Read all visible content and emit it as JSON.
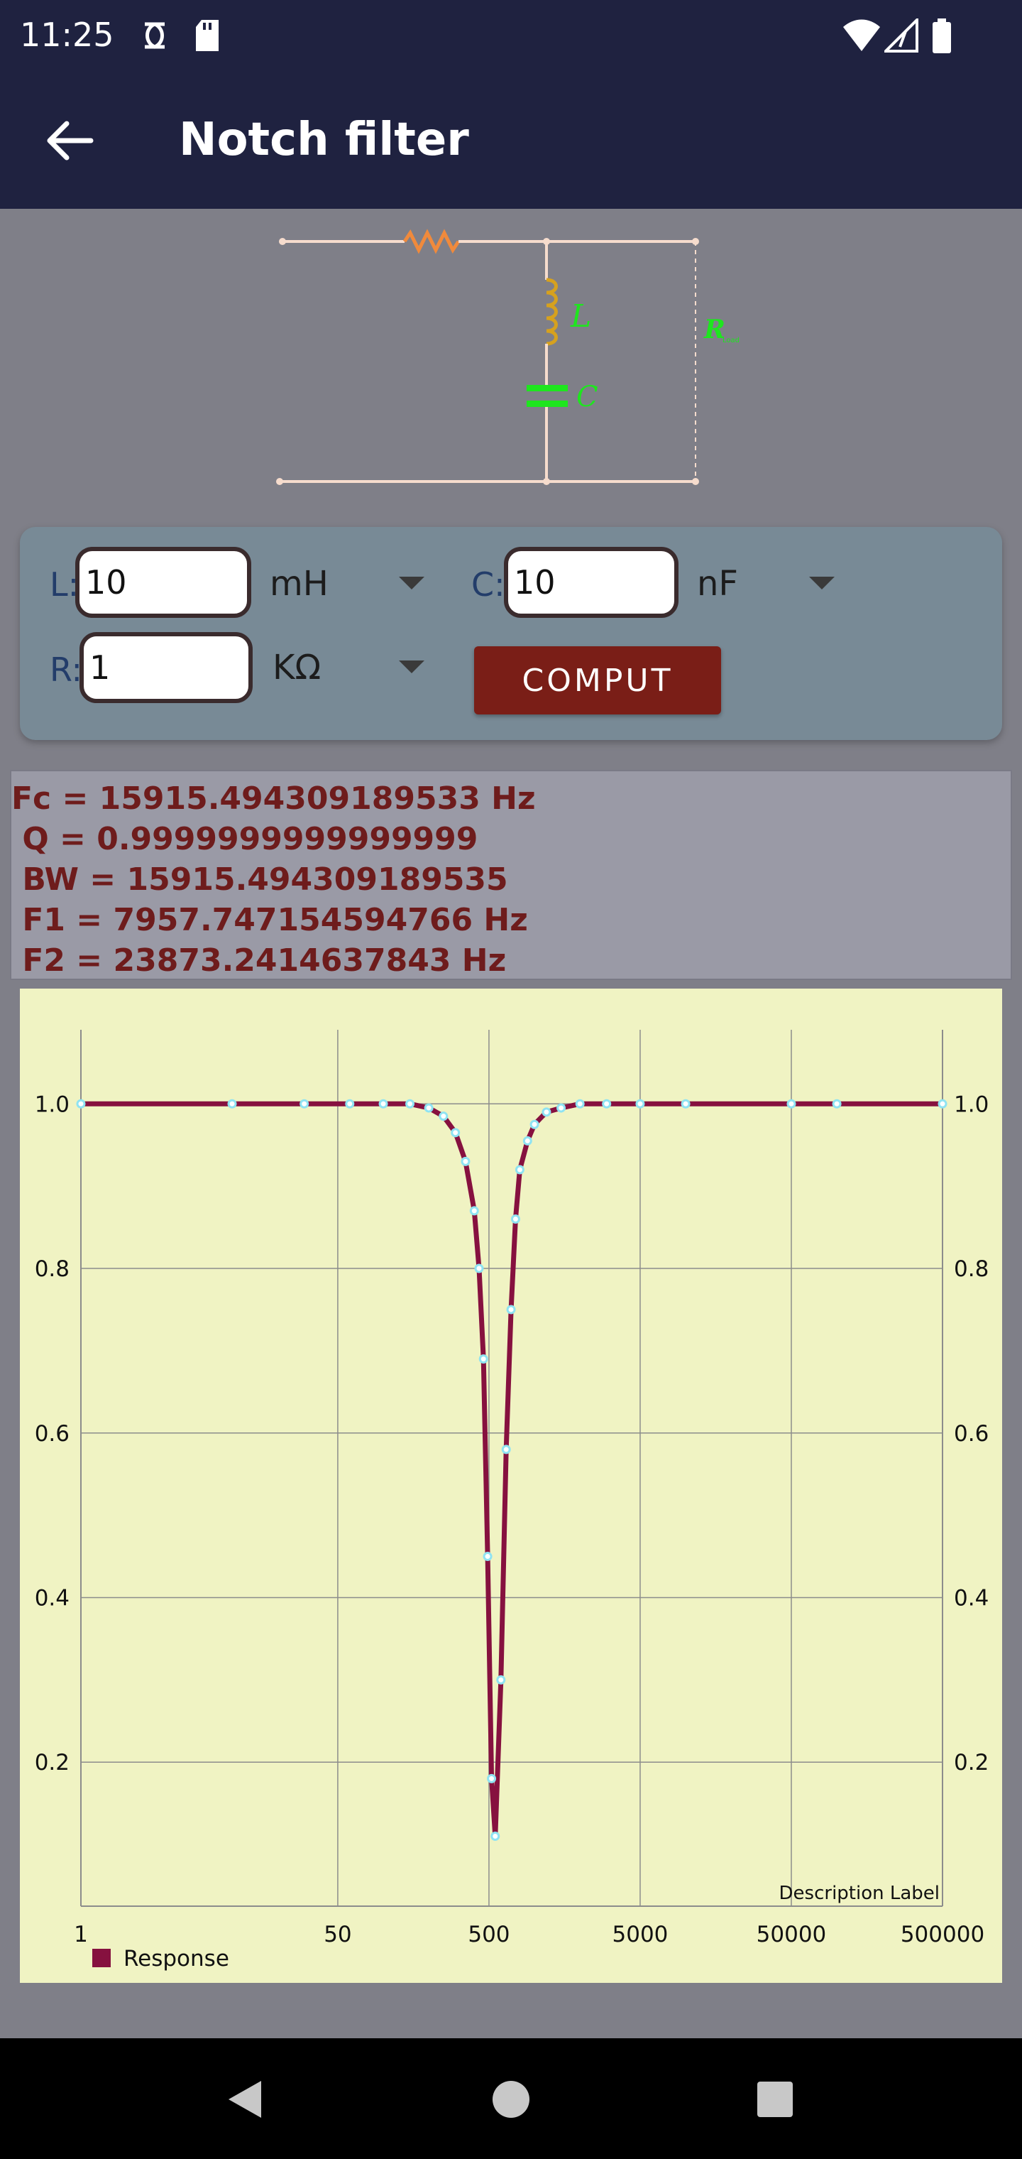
{
  "status": {
    "time": "11:25"
  },
  "app_bar": {
    "title": "Notch filter"
  },
  "diagram": {
    "label_l": "L",
    "label_c": "C",
    "label_r": "R",
    "label_r_sub": "Load"
  },
  "inputs": {
    "l": {
      "label": "L:",
      "value": "10",
      "unit": "mH"
    },
    "c": {
      "label": "C:",
      "value": "10",
      "unit": "nF"
    },
    "r": {
      "label": "R:",
      "value": "1",
      "unit": "KΩ"
    },
    "compute_label": "COMPUT"
  },
  "results": {
    "fc": "Fc = 15915.494309189533 Hz",
    "q": " Q = 0.9999999999999999",
    "bw": " BW = 15915.494309189535",
    "f1": " F1 = 7957.747154594766 Hz",
    "f2": " F2 = 23873.2414637843 Hz"
  },
  "colors": {
    "line": "#86113f",
    "marker": "#8fe3f2",
    "bg": "#f0f3c3"
  },
  "chart_data": {
    "type": "line",
    "xscale": "log",
    "x_ticks": [
      1,
      50,
      500,
      5000,
      50000,
      500000
    ],
    "x_tick_labels": [
      "1",
      "50",
      "500",
      "5000",
      "50000",
      "500000"
    ],
    "y_ticks": [
      0.2,
      0.4,
      0.6,
      0.8,
      1.0
    ],
    "y_tick_labels": [
      "0.2",
      "0.4",
      "0.6",
      "0.8",
      "1.0"
    ],
    "ylim": [
      0.025,
      1.09
    ],
    "grid": true,
    "description": "Description Label",
    "legend_position": "bottom-left",
    "series": [
      {
        "name": "Response",
        "x": [
          1,
          10,
          30,
          60,
          100,
          150,
          200,
          250,
          300,
          350,
          400,
          430,
          460,
          490,
          520,
          550,
          600,
          650,
          700,
          750,
          800,
          900,
          1000,
          1200,
          1500,
          2000,
          3000,
          5000,
          10000,
          50000,
          100000,
          500000
        ],
        "y": [
          1.0,
          1.0,
          1.0,
          1.0,
          1.0,
          1.0,
          0.995,
          0.985,
          0.965,
          0.93,
          0.87,
          0.8,
          0.69,
          0.45,
          0.18,
          0.11,
          0.3,
          0.58,
          0.75,
          0.86,
          0.92,
          0.955,
          0.975,
          0.99,
          0.995,
          1.0,
          1.0,
          1.0,
          1.0,
          1.0,
          1.0,
          1.0
        ]
      }
    ]
  }
}
